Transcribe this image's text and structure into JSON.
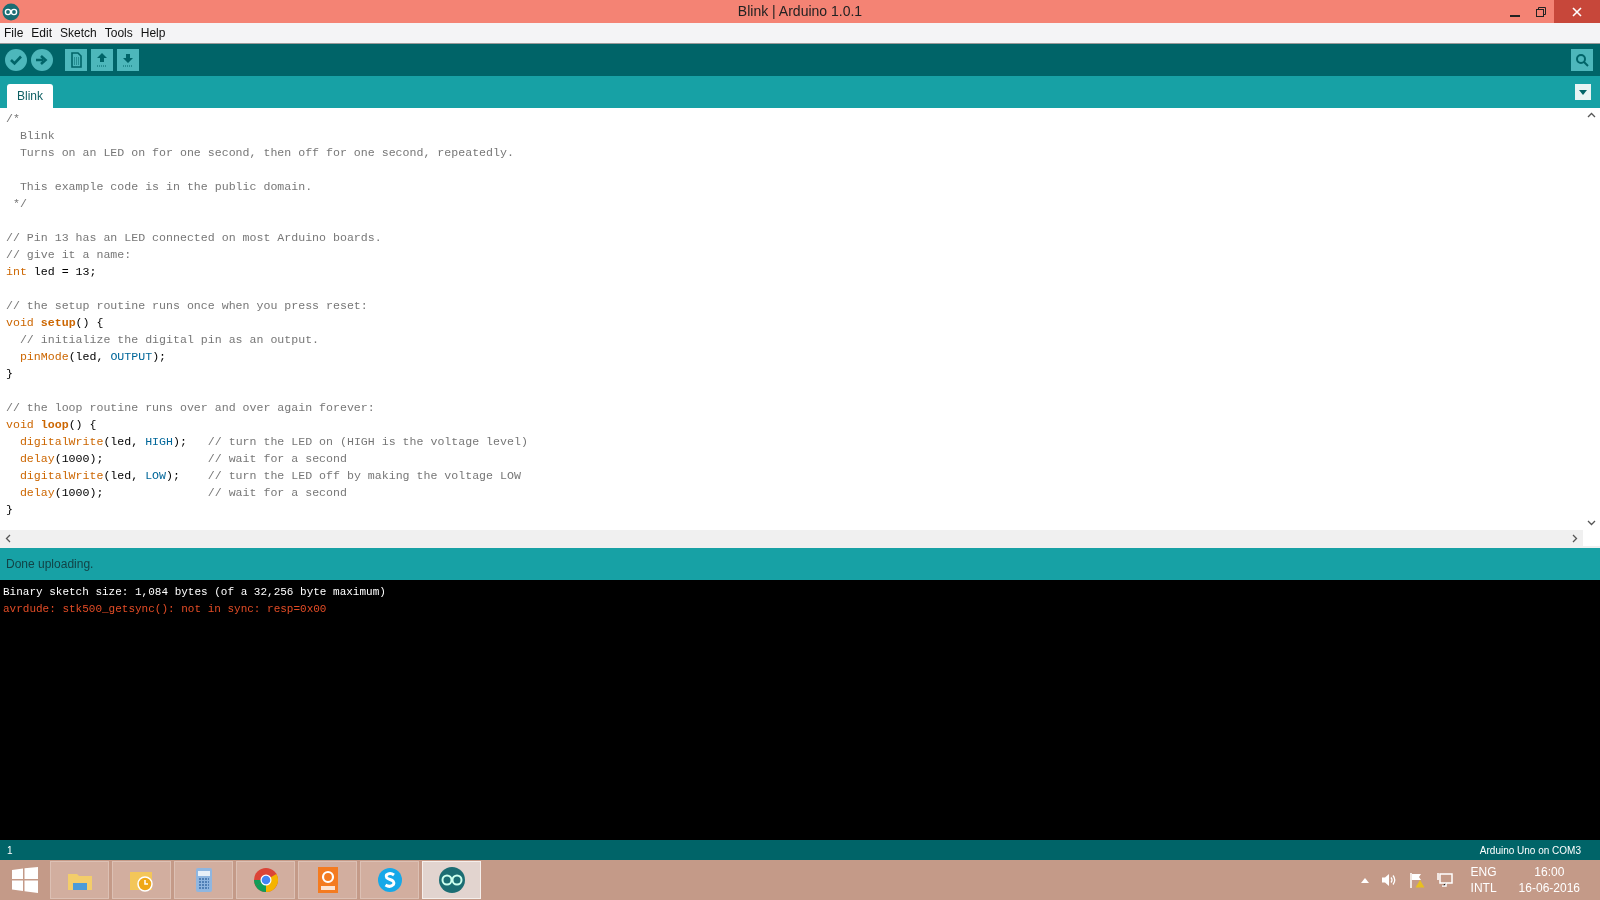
{
  "window": {
    "title": "Blink | Arduino 1.0.1"
  },
  "menu": [
    "File",
    "Edit",
    "Sketch",
    "Tools",
    "Help"
  ],
  "toolbar": [
    {
      "kind": "verify"
    },
    {
      "kind": "upload"
    },
    {
      "kind": "new"
    },
    {
      "kind": "open"
    },
    {
      "kind": "save"
    }
  ],
  "tabs": [
    {
      "label": "Blink",
      "selected": true
    }
  ],
  "editor": {
    "blocks": [
      {
        "lines": [
          [
            {
              "kind": "comment",
              "text": "/*"
            }
          ],
          [
            {
              "kind": "comment",
              "text": "  Blink"
            }
          ],
          [
            {
              "kind": "comment",
              "text": "  Turns on an LED on for one second, then off for one second, repeatedly."
            }
          ]
        ]
      },
      {
        "lines": [
          [
            {
              "kind": "comment",
              "text": "  This example code is in the public domain."
            }
          ],
          [
            {
              "kind": "comment",
              "text": " */"
            }
          ]
        ]
      },
      {
        "lines": [
          [
            {
              "kind": "comment",
              "text": "// Pin 13 has an LED connected on most Arduino boards."
            }
          ],
          [
            {
              "kind": "comment",
              "text": "// give it a name:"
            }
          ],
          [
            {
              "kind": "keyword",
              "text": "int"
            },
            {
              "kind": "plain",
              "text": " led = 13;"
            }
          ]
        ]
      },
      {
        "lines": [
          [
            {
              "kind": "comment",
              "text": "// the setup routine runs once when you press reset:"
            }
          ],
          [
            {
              "kind": "keyword",
              "text": "void "
            },
            {
              "kind": "bold",
              "text": "setup"
            },
            {
              "kind": "plain",
              "text": "() {"
            }
          ],
          [
            {
              "kind": "comment",
              "text": "  // initialize the digital pin as an output."
            }
          ],
          [
            {
              "kind": "function",
              "text": "  pinMode"
            },
            {
              "kind": "plain",
              "text": "(led, "
            },
            {
              "kind": "constant",
              "text": "OUTPUT"
            },
            {
              "kind": "plain",
              "text": ");"
            }
          ],
          [
            {
              "kind": "plain",
              "text": "}"
            }
          ]
        ]
      },
      {
        "lines": [
          [
            {
              "kind": "comment",
              "text": "// the loop routine runs over and over again forever:"
            }
          ],
          [
            {
              "kind": "keyword",
              "text": "void "
            },
            {
              "kind": "bold",
              "text": "loop"
            },
            {
              "kind": "plain",
              "text": "() {"
            }
          ],
          [
            {
              "kind": "function",
              "text": "  digitalWrite"
            },
            {
              "kind": "plain",
              "text": "(led, "
            },
            {
              "kind": "constant",
              "text": "HIGH"
            },
            {
              "kind": "plain",
              "text": ");   "
            },
            {
              "kind": "comment",
              "text": "// turn the LED on (HIGH is the voltage level)"
            }
          ],
          [
            {
              "kind": "function",
              "text": "  delay"
            },
            {
              "kind": "plain",
              "text": "(1000);               "
            },
            {
              "kind": "comment",
              "text": "// wait for a second"
            }
          ],
          [
            {
              "kind": "function",
              "text": "  digitalWrite"
            },
            {
              "kind": "plain",
              "text": "(led, "
            },
            {
              "kind": "constant",
              "text": "LOW"
            },
            {
              "kind": "plain",
              "text": ");    "
            },
            {
              "kind": "comment",
              "text": "// turn the LED off by making the voltage LOW"
            }
          ],
          [
            {
              "kind": "function",
              "text": "  delay"
            },
            {
              "kind": "plain",
              "text": "(1000);               "
            },
            {
              "kind": "comment",
              "text": "// wait for a second"
            }
          ],
          [
            {
              "kind": "plain",
              "text": "}"
            }
          ]
        ]
      }
    ]
  },
  "status": "Done uploading.",
  "console": [
    {
      "kind": "info",
      "text": "Binary sketch size: 1,084 bytes (of a 32,256 byte maximum)"
    },
    {
      "kind": "error",
      "text": "avrdude: stk500_getsync(): not in sync: resp=0x00"
    }
  ],
  "bottom_bar": {
    "line_number": "1",
    "board": "Arduino Uno on COM3"
  },
  "taskbar": {
    "apps": [
      {
        "kind": "explorer",
        "selected": false
      },
      {
        "kind": "mail",
        "selected": false
      },
      {
        "kind": "calculator",
        "selected": false
      },
      {
        "kind": "browser",
        "selected": false
      },
      {
        "kind": "pdf",
        "selected": false
      },
      {
        "kind": "skype",
        "selected": false
      },
      {
        "kind": "arduino",
        "selected": true
      }
    ],
    "language": "ENG",
    "layout": "INTL",
    "time": "16:00",
    "date": "16-06-2016"
  }
}
